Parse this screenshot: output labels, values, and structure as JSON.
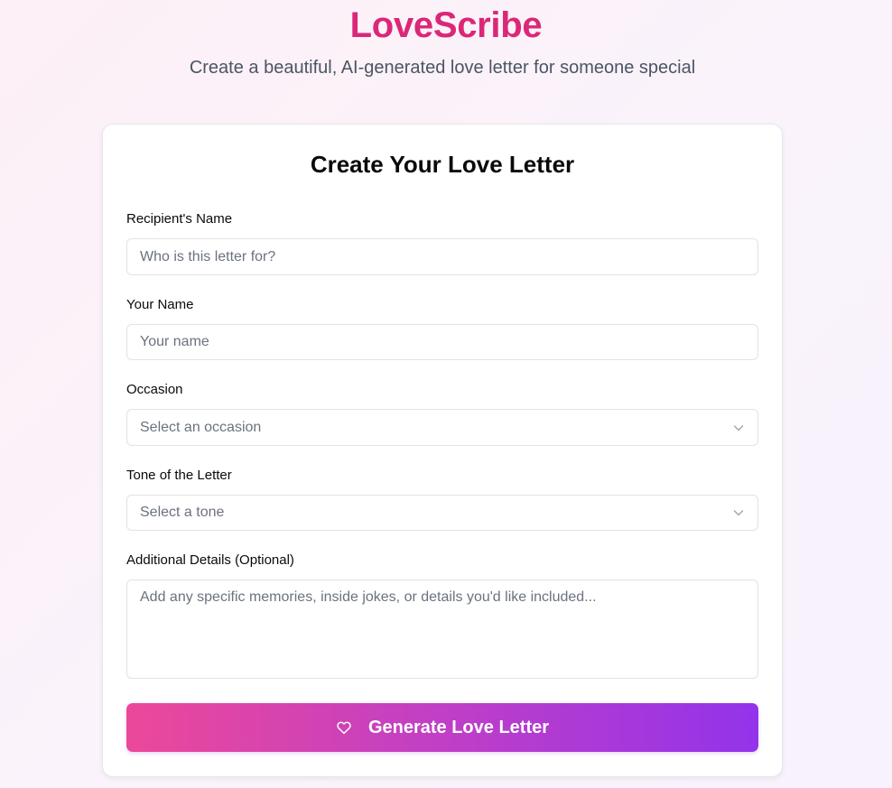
{
  "header": {
    "title": "LoveScribe",
    "subtitle": "Create a beautiful, AI-generated love letter for someone special"
  },
  "form": {
    "title": "Create Your Love Letter",
    "recipient": {
      "label": "Recipient's Name",
      "placeholder": "Who is this letter for?",
      "value": ""
    },
    "sender": {
      "label": "Your Name",
      "placeholder": "Your name",
      "value": ""
    },
    "occasion": {
      "label": "Occasion",
      "selected": "Select an occasion"
    },
    "tone": {
      "label": "Tone of the Letter",
      "selected": "Select a tone"
    },
    "details": {
      "label": "Additional Details (Optional)",
      "placeholder": "Add any specific memories, inside jokes, or details you'd like included...",
      "value": ""
    },
    "submit_label": "Generate Love Letter"
  },
  "icons": {
    "select_chevron": "chevron-down-icon",
    "submit_icon": "heart-icon"
  },
  "colors": {
    "brand": "#db2777",
    "button_gradient_start": "#ec4899",
    "button_gradient_end": "#9333ea"
  }
}
